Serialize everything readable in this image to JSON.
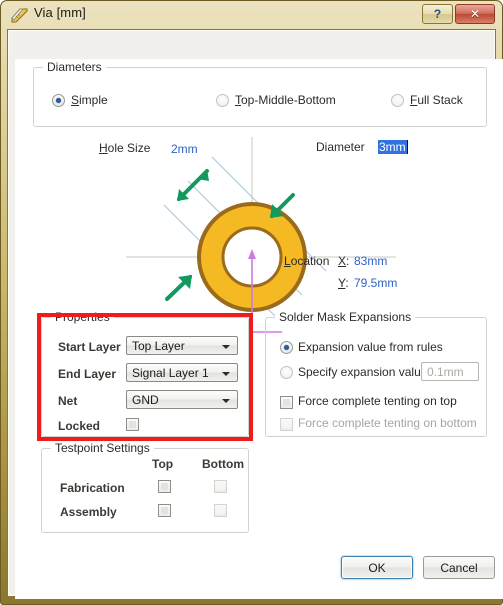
{
  "window": {
    "title": "Via [mm]",
    "icon": "via-ruler-icon",
    "help_label": "?",
    "close_label": "✕"
  },
  "diameters": {
    "group_title": "Diameters",
    "options": [
      {
        "label": "Simple",
        "accel": "S",
        "selected": true
      },
      {
        "label": "Top-Middle-Bottom",
        "accel": "T",
        "selected": false
      },
      {
        "label": "Full Stack",
        "accel": "F",
        "selected": false
      }
    ]
  },
  "preview": {
    "hole_size_label": "Hole Size",
    "hole_size_accel": "H",
    "hole_size_value": "2mm",
    "diameter_label": "Diameter",
    "diameter_value": "3mm",
    "location_label": "Location",
    "location_accel": "L",
    "x_label": "X:",
    "x_value": "83mm",
    "y_label": "Y:",
    "y_value": "79.5mm",
    "colors": {
      "via_fill": "#f5b924",
      "via_ring_outline": "#9a6b1c",
      "dimension_arrow": "#11995e",
      "dimension_line": "#9ec9e8",
      "origin_marker": "#cf7ae0",
      "value_text": "#2d61c4",
      "highlight": "#ee1c1c"
    }
  },
  "properties": {
    "group_title": "Properties",
    "highlighted": true,
    "rows": [
      {
        "label": "Start Layer",
        "value": "Top Layer",
        "type": "combo"
      },
      {
        "label": "End Layer",
        "value": "Signal Layer 1",
        "type": "combo"
      },
      {
        "label": "Net",
        "value": "GND",
        "type": "combo"
      }
    ],
    "locked_label": "Locked",
    "locked_checked": false
  },
  "solder_mask": {
    "group_title": "Solder Mask Expansions",
    "from_rules_label": "Expansion value from rules",
    "from_rules_selected": true,
    "specify_label": "Specify expansion value",
    "specify_selected": false,
    "specify_placeholder": "0.1mm",
    "tent_top_label": "Force complete tenting on top",
    "tent_top_checked": false,
    "tent_top_disabled": false,
    "tent_bottom_label": "Force complete tenting on bottom",
    "tent_bottom_checked": false,
    "tent_bottom_disabled": true
  },
  "testpoint": {
    "group_title": "Testpoint Settings",
    "col_top": "Top",
    "col_bottom": "Bottom",
    "rows": [
      {
        "label": "Fabrication",
        "top_checked": false,
        "bottom_checked": false,
        "bottom_disabled": true
      },
      {
        "label": "Assembly",
        "top_checked": false,
        "bottom_checked": false,
        "bottom_disabled": true
      }
    ]
  },
  "footer": {
    "ok_label": "OK",
    "cancel_label": "Cancel"
  }
}
